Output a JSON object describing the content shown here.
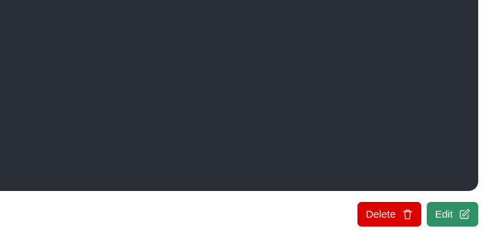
{
  "actions": {
    "delete_label": "Delete",
    "delete_icon": "trash-icon",
    "delete_color": "#dc0000",
    "edit_label": "Edit",
    "edit_icon": "pencil-square-icon",
    "edit_color": "#2f9266"
  },
  "colors": {
    "panel_background": "#2a2e35",
    "page_background": "#ffffff"
  }
}
